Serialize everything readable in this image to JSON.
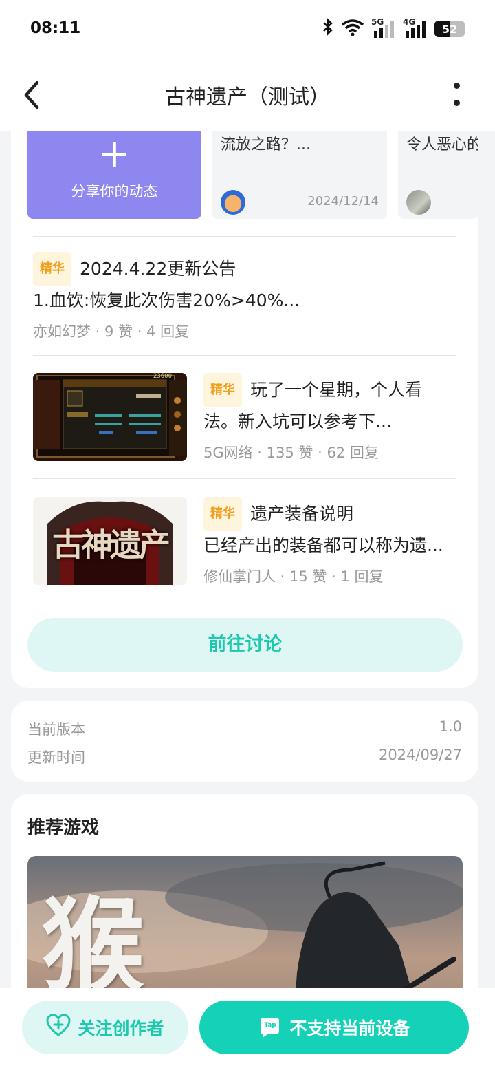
{
  "status_bar": {
    "time": "08:11",
    "network_5g": "5G",
    "network_4g": "4G",
    "battery": "52",
    "battery_level": 0.52
  },
  "header": {
    "title": "古神遗产（测试）"
  },
  "share_tile": {
    "plus": "+",
    "label": "分享你的动态"
  },
  "mini_posts": [
    {
      "text": "流放之路？...",
      "date": "2024/12/14"
    },
    {
      "text": "令人恶心的",
      "date": ""
    }
  ],
  "posts": [
    {
      "tag": "精华",
      "title": "2024.4.22更新公告",
      "line2": "1.血饮:恢复此次伤害20%>40%...",
      "meta": "亦如幻梦 · 9 赞 · 4 回复"
    },
    {
      "tag": "精华",
      "title": "玩了一个星期，个人看",
      "line2": "法。新入坑可以参考下...",
      "meta": "5G网络 · 135 赞 · 62 回复"
    },
    {
      "tag": "精华",
      "title": "遗产装备说明",
      "line2": "已经产出的装备都可以称为遗...",
      "meta": "修仙掌门人 · 15 赞 · 1 回复"
    }
  ],
  "thumb_texts": {
    "gold": "23600",
    "logo": "古神遗产"
  },
  "discuss_button": "前往讨论",
  "version_info": [
    {
      "label": "当前版本",
      "value": "1.0"
    },
    {
      "label": "更新时间",
      "value": "2024/09/27"
    }
  ],
  "recommend": {
    "title": "推荐游戏",
    "banner_text": "猴"
  },
  "bottom": {
    "follow_label": "关注创作者",
    "main_label": "不支持当前设备",
    "tap_icon_text": "Tap"
  },
  "colors": {
    "accent": "#15d1b8",
    "accent_light": "#dff7f4",
    "tag_bg": "#fff4dc",
    "tag_text": "#f0a020",
    "share_tile": "#8f87f0"
  }
}
